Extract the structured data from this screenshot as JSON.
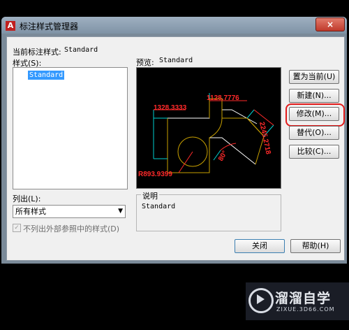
{
  "window": {
    "title": "标注样式管理器",
    "close_icon": "×"
  },
  "left": {
    "current_label": "当前标注样式:",
    "current_value": "Standard",
    "styles_label": "样式(S):",
    "styles_list": [
      "Standard"
    ],
    "list_label": "列出(L):",
    "list_selected": "所有样式",
    "checkbox_label": "不列出外部参照中的样式(D)"
  },
  "preview": {
    "label": "预览:",
    "value": "Standard",
    "dims": [
      "1128.7776",
      "1328.3333",
      "2245.2718",
      "80°",
      "R893.9399"
    ]
  },
  "description": {
    "label": "说明",
    "value": "Standard"
  },
  "buttons": {
    "set_current": "置为当前(U)",
    "new": "新建(N)...",
    "modify": "修改(M)...",
    "override": "替代(O)...",
    "compare": "比较(C)...",
    "close": "关闭",
    "help": "帮助(H)"
  },
  "watermark": {
    "text": "溜溜自学",
    "url": "ZIXUE.3D66.COM"
  }
}
